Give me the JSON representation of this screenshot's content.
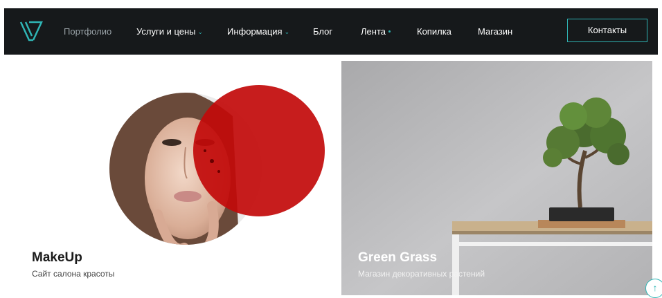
{
  "nav": {
    "items": [
      {
        "label": "Портфолио"
      },
      {
        "label": "Услуги и цены"
      },
      {
        "label": "Информация"
      },
      {
        "label": "Блог"
      },
      {
        "label": "Лента"
      },
      {
        "label": "Копилка"
      },
      {
        "label": "Магазин"
      }
    ],
    "contact_label": "Контакты"
  },
  "portfolio": [
    {
      "title": "MakeUp",
      "subtitle": "Сайт салона красоты"
    },
    {
      "title": "Green Grass",
      "subtitle": "Магазин декоративных растений"
    }
  ],
  "colors": {
    "nav_bg": "#16191b",
    "accent": "#2fb5b5",
    "red": "#c20a0a"
  }
}
